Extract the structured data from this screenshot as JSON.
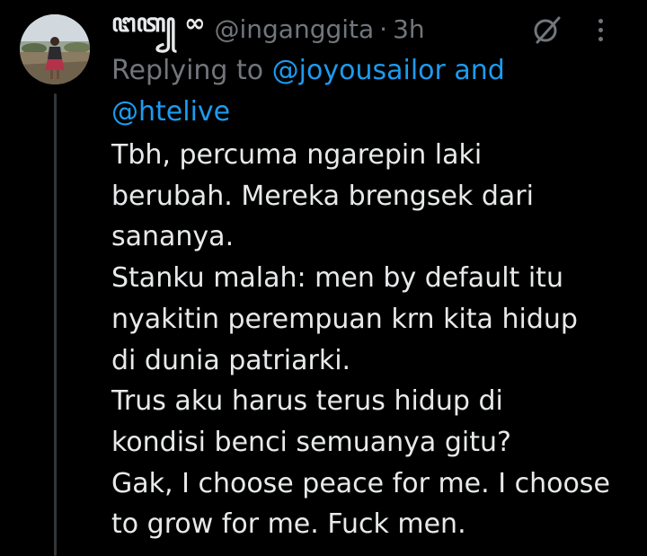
{
  "tweet": {
    "author": {
      "display_name": "ꦔꦠ꧀ ∞",
      "handle": "@inganggita",
      "separator": "·",
      "time": "3h",
      "avatar_icon": "user-avatar-photo"
    },
    "replying": {
      "prefix": "Replying to ",
      "mention_1": "@joyousailor",
      "joiner": " and",
      "mention_2": "@htelive"
    },
    "text_lines": [
      "Tbh, percuma ngarepin laki",
      "berubah. Mereka brengsek dari",
      "sananya.",
      "Stanku malah: men by default itu",
      "nyakitin perempuan krn kita hidup",
      "di dunia patriarki.",
      "Trus aku harus terus hidup di",
      "kondisi benci semuanya gitu?",
      "Gak, I choose peace for me. I choose",
      "to grow for me. Fuck men."
    ],
    "icons": {
      "grok": "grok-icon",
      "more": "more-options-icon"
    }
  },
  "colors": {
    "background": "#000000",
    "text_primary": "#e7e9ea",
    "text_secondary": "#71767b",
    "accent_link": "#1d9bf0",
    "thread_line": "#333639"
  }
}
